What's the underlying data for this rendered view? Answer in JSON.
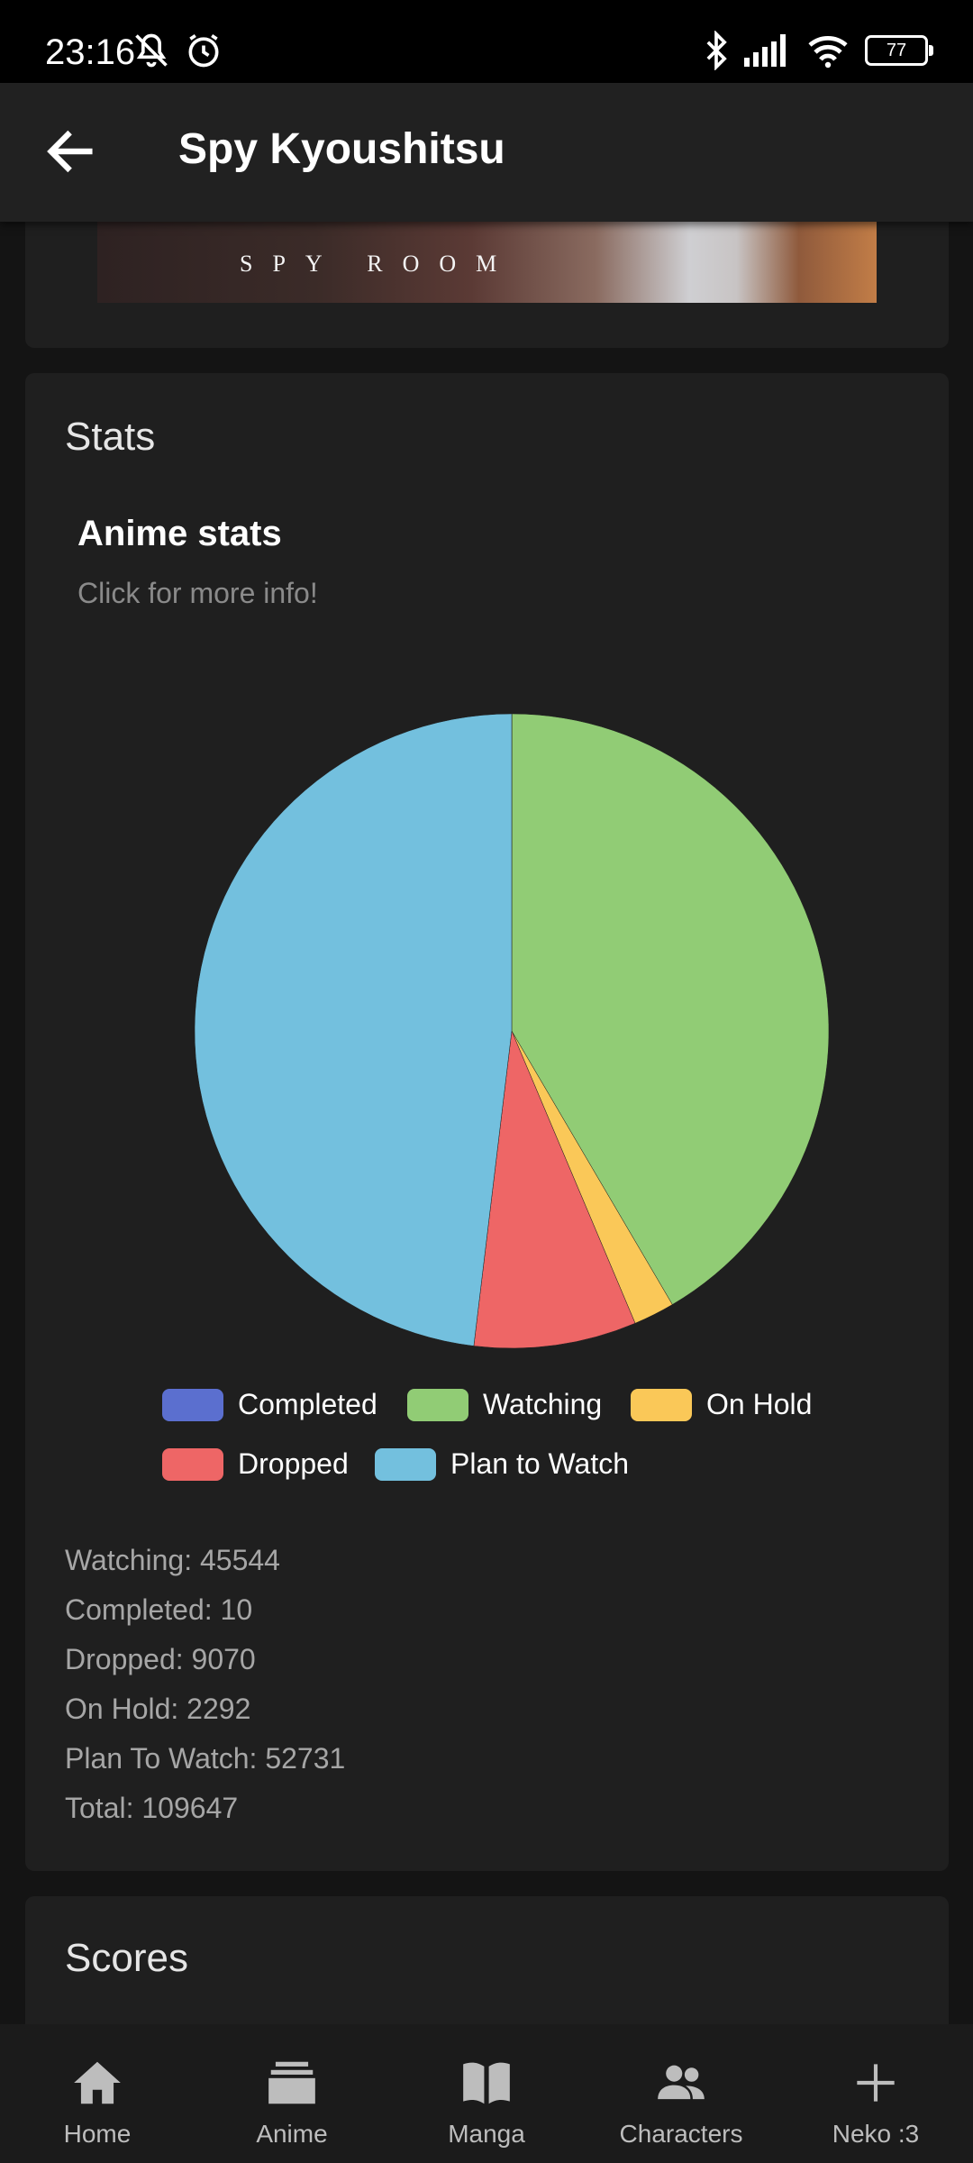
{
  "status_bar": {
    "time": "23:16",
    "battery": "77"
  },
  "app_bar": {
    "title": "Spy Kyoushitsu"
  },
  "cover": {
    "text": "SPY ROOM"
  },
  "stats_card": {
    "heading": "Stats",
    "lines": [
      "Watching: 45544",
      "Completed: 10",
      "Dropped: 9070",
      "On Hold: 2292",
      "Plan To Watch: 52731",
      "Total: 109647"
    ]
  },
  "chart_data": {
    "type": "pie",
    "title": "Anime stats",
    "subtitle": "Click for more info!",
    "legend_position": "bottom",
    "slices": [
      {
        "label": "Completed",
        "value": 10,
        "color": "#5b6fcf"
      },
      {
        "label": "Watching",
        "value": 45544,
        "color": "#91cc75"
      },
      {
        "label": "On Hold",
        "value": 2292,
        "color": "#fac858"
      },
      {
        "label": "Dropped",
        "value": 9070,
        "color": "#ee6666"
      },
      {
        "label": "Plan to Watch",
        "value": 52731,
        "color": "#73c0de"
      }
    ]
  },
  "scores_card": {
    "heading": "Scores"
  },
  "bottom_nav": {
    "items": [
      {
        "label": "Home",
        "icon": "home-icon"
      },
      {
        "label": "Anime",
        "icon": "stack-icon"
      },
      {
        "label": "Manga",
        "icon": "book-icon"
      },
      {
        "label": "Characters",
        "icon": "people-icon"
      },
      {
        "label": "Neko :3",
        "icon": "plus-icon"
      }
    ]
  }
}
